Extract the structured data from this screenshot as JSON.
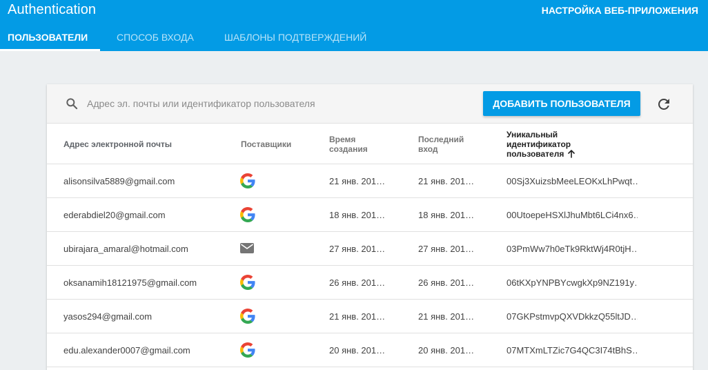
{
  "header": {
    "title": "Authentication",
    "webapp_link": "НАСТРОЙКА ВЕБ-ПРИЛОЖЕНИЯ",
    "tabs": [
      {
        "label": "ПОЛЬЗОВАТЕЛИ",
        "active": true
      },
      {
        "label": "СПОСОБ ВХОДА",
        "active": false
      },
      {
        "label": "ШАБЛОНЫ ПОДТВЕРЖДЕНИЙ",
        "active": false
      }
    ],
    "accent_color": "#039be5"
  },
  "toolbar": {
    "search_placeholder": "Адрес эл. почты или идентификатор пользователя",
    "add_user_label": "ДОБАВИТЬ ПОЛЬЗОВАТЕЛЯ",
    "search_icon": "search-icon",
    "refresh_icon": "refresh-icon"
  },
  "table": {
    "columns": {
      "email": "Адрес электронной почты",
      "providers": "Поставщики",
      "created": "Время создания",
      "last_signin": "Последний вход",
      "uid": "Уникальный идентификатор пользователя"
    },
    "sorted_by": "uid",
    "sort_direction": "ascending",
    "rows": [
      {
        "email": "alisonsilva5889@gmail.com",
        "provider": "google",
        "created": "21 янв. 201…",
        "last_signin": "21 янв. 201…",
        "uid": "00Sj3XuizsbMeeLEOKxLhPwqt…"
      },
      {
        "email": "ederabdiel20@gmail.com",
        "provider": "google",
        "created": "18 янв. 201…",
        "last_signin": "18 янв. 201…",
        "uid": "00UtoepeHSXlJhuMbt6LCi4nx6…"
      },
      {
        "email": "ubirajara_amaral@hotmail.com",
        "provider": "email",
        "created": "27 янв. 201…",
        "last_signin": "27 янв. 201…",
        "uid": "03PmWw7h0eTk9RktWj4R0tjH…"
      },
      {
        "email": "oksanamih18121975@gmail.com",
        "provider": "google",
        "created": "26 янв. 201…",
        "last_signin": "26 янв. 201…",
        "uid": "06tKXpYNPBYcwgkXp9NZ191y…"
      },
      {
        "email": "yasos294@gmail.com",
        "provider": "google",
        "created": "21 янв. 201…",
        "last_signin": "21 янв. 201…",
        "uid": "07GKPstmvpQXVDkkzQ55ltJD…"
      },
      {
        "email": "edu.alexander0007@gmail.com",
        "provider": "google",
        "created": "20 янв. 201…",
        "last_signin": "20 янв. 201…",
        "uid": "07MTXmLTZic7G4QC3I74tBhS…"
      }
    ]
  }
}
